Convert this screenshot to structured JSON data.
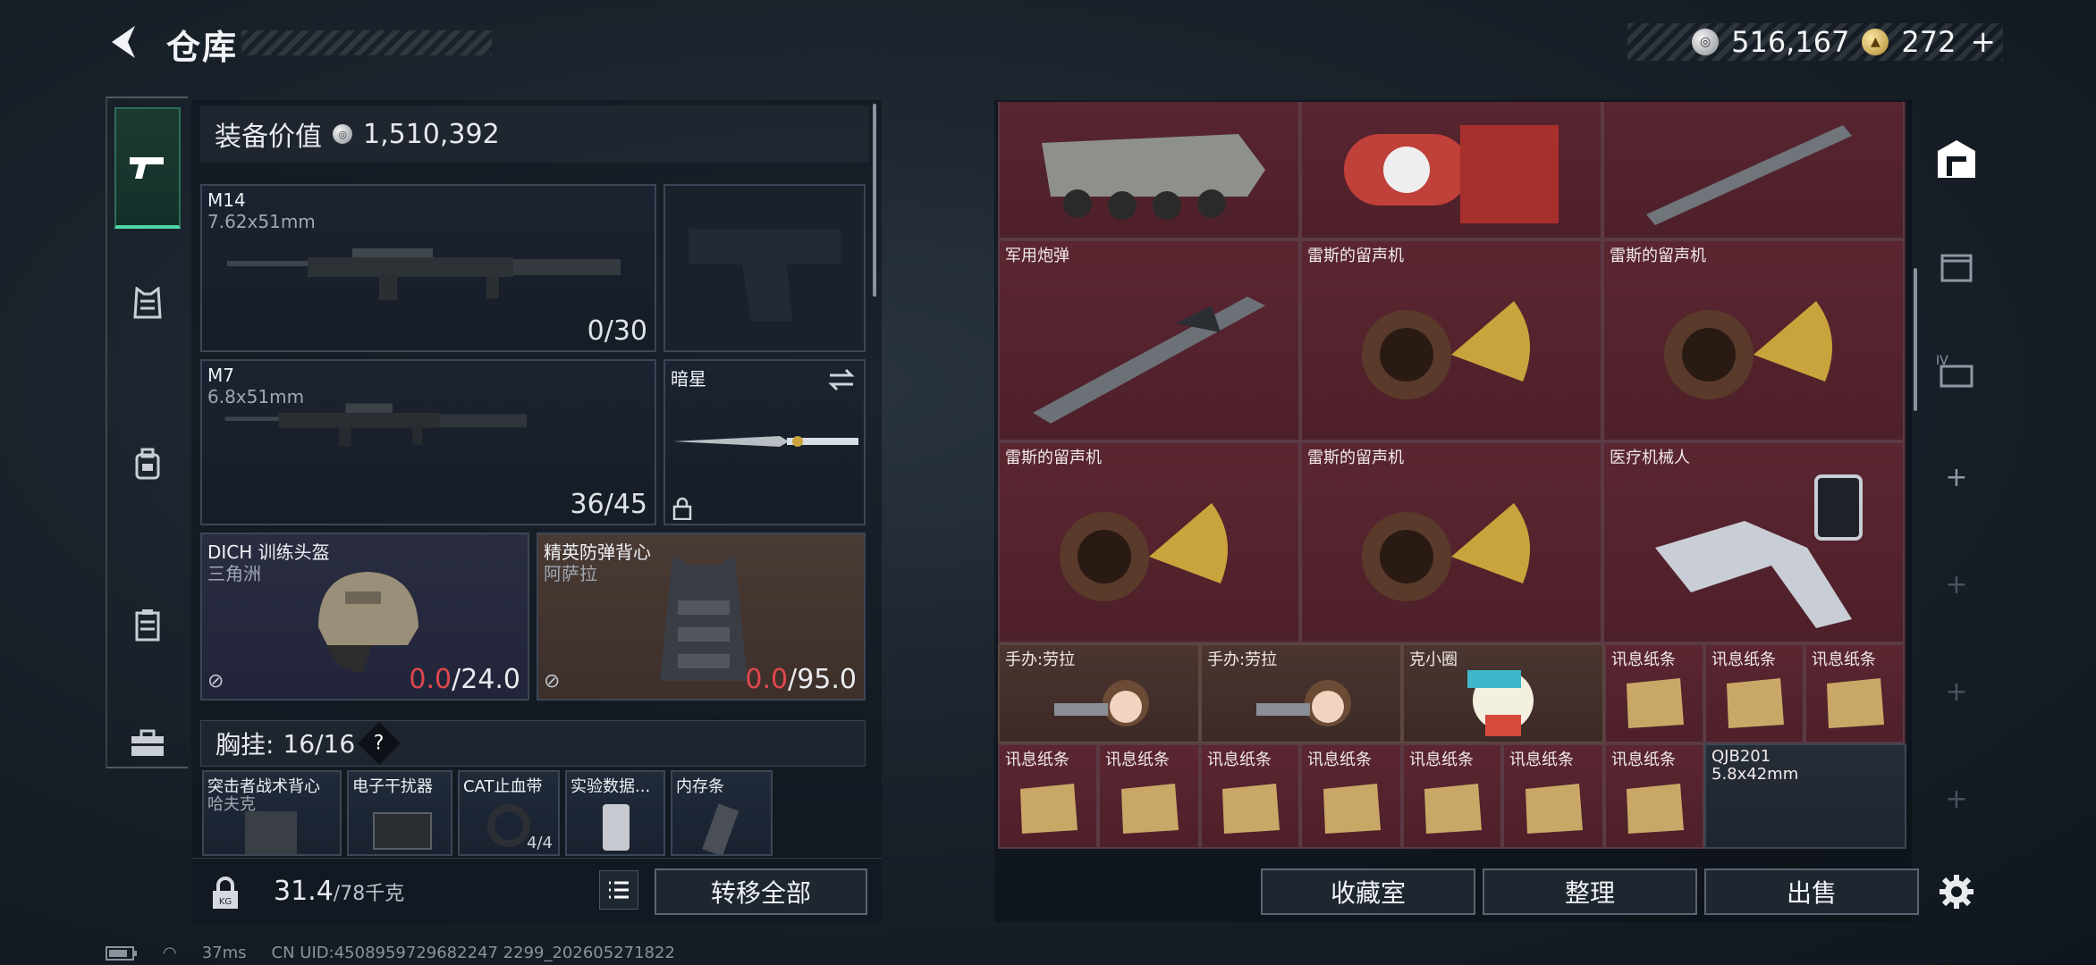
{
  "header": {
    "title": "仓库",
    "currency": [
      {
        "icon": "silver-coin-icon",
        "value": "516,167"
      },
      {
        "icon": "gold-coin-icon",
        "value": "272"
      }
    ],
    "add_label": "+"
  },
  "left_nav": {
    "items": [
      "pistol-icon",
      "armor-vest-icon",
      "backpack-icon",
      "chest-rig-icon",
      "briefcase-icon"
    ]
  },
  "equipment": {
    "value_label": "装备价值",
    "value": "1,510,392",
    "primary": {
      "name": "M14",
      "caliber": "7.62x51mm",
      "ammo": "0/30"
    },
    "secondary": {
      "name": "M7",
      "caliber": "6.8x51mm",
      "ammo": "36/45"
    },
    "melee": {
      "name": "暗星"
    },
    "helmet": {
      "name": "DICH 训练头盔",
      "sub": "三角洲",
      "dur_current": "0.0",
      "dur_max": "/24.0"
    },
    "armor": {
      "name": "精英防弹背心",
      "sub": "阿萨拉",
      "dur_current": "0.0",
      "dur_max": "/95.0"
    },
    "chest": {
      "label": "胸挂:",
      "count": "16/16",
      "help": "?"
    },
    "chest_items": [
      {
        "name": "突击者战术背心",
        "sub": "哈夫克"
      },
      {
        "name": "电子干扰器"
      },
      {
        "name": "CAT止血带",
        "sub": "4/4"
      },
      {
        "name": "实验数据..."
      },
      {
        "name": "内存条"
      }
    ]
  },
  "footer_left": {
    "weight": "31.4",
    "weight_unit": "/78千克",
    "transfer_all": "转移全部"
  },
  "stash": {
    "rows": [
      [
        "",
        "",
        ""
      ],
      [
        "军用炮弹",
        "雷斯的留声机",
        "雷斯的留声机"
      ],
      [
        "雷斯的留声机",
        "雷斯的留声机",
        "医疗机械人"
      ],
      [
        "手办:劳拉",
        "手办:劳拉",
        "克小圈",
        "讯息纸条",
        "讯息纸条",
        "讯息纸条"
      ],
      [
        "讯息纸条",
        "讯息纸条",
        "讯息纸条",
        "讯息纸条",
        "讯息纸条",
        "讯息纸条",
        "讯息纸条"
      ]
    ],
    "qjb": {
      "name": "QJB201",
      "caliber": "5.8x42mm"
    }
  },
  "footer_right": {
    "collection": "收藏室",
    "organize": "整理",
    "sell": "出售"
  },
  "status": {
    "ping": "37ms",
    "uid": "CN UID:4508959729682247 2299_202605271822"
  },
  "colors": {
    "accent": "#4fd8a6",
    "durability_red": "#e0474c",
    "stash_red": "#5a2631"
  }
}
